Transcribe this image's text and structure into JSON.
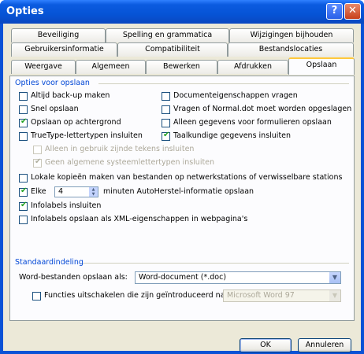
{
  "window": {
    "title": "Opties"
  },
  "tabs_row1": [
    "Beveiliging",
    "Spelling en grammatica",
    "Wijzigingen bijhouden"
  ],
  "tabs_row2": [
    "Gebruikersinformatie",
    "Compatibiliteit",
    "Bestandslocaties"
  ],
  "tabs_row3": [
    "Weergave",
    "Algemeen",
    "Bewerken",
    "Afdrukken",
    "Opslaan"
  ],
  "save_options": {
    "title": "Opties voor opslaan",
    "left": [
      {
        "label": "Altijd back-up maken",
        "checked": false
      },
      {
        "label": "Snel opslaan",
        "checked": false
      },
      {
        "label": "Opslaan op achtergrond",
        "checked": true
      },
      {
        "label": "TrueType-lettertypen insluiten",
        "checked": false
      }
    ],
    "right": [
      {
        "label": "Documenteigenschappen vragen",
        "checked": false
      },
      {
        "label": "Vragen of Normal.dot moet worden opgeslagen",
        "checked": false
      },
      {
        "label": "Alleen gegevens voor formulieren opslaan",
        "checked": false
      },
      {
        "label": "Taalkundige gegevens insluiten",
        "checked": true
      }
    ],
    "sub": [
      {
        "label": "Alleen in gebruik zijnde tekens insluiten",
        "checked": false
      },
      {
        "label": "Geen algemene systeemlettertypen insluiten",
        "checked": true
      }
    ],
    "local_copies": "Lokale kopieën maken van bestanden op netwerkstations of verwisselbare stations",
    "every_label": "Elke",
    "every_value": "4",
    "every_suffix": "minuten AutoHerstel-informatie opslaan",
    "smarttags_embed": "Infolabels insluiten",
    "smarttags_xml": "Infolabels opslaan als XML-eigenschappen in webpagina's"
  },
  "defaults": {
    "title": "Standaardindeling",
    "save_as_label": "Word-bestanden opslaan als:",
    "save_as_value": "Word-document (*.doc)",
    "disable_features_label": "Functies uitschakelen die zijn geïntroduceerd na:",
    "disable_features_value": "Microsoft Word 97"
  },
  "buttons": {
    "ok": "OK",
    "cancel": "Annuleren"
  },
  "colors": {
    "titlebar": "#0654d6",
    "group_title": "#0046d5",
    "check": "#21a121"
  }
}
